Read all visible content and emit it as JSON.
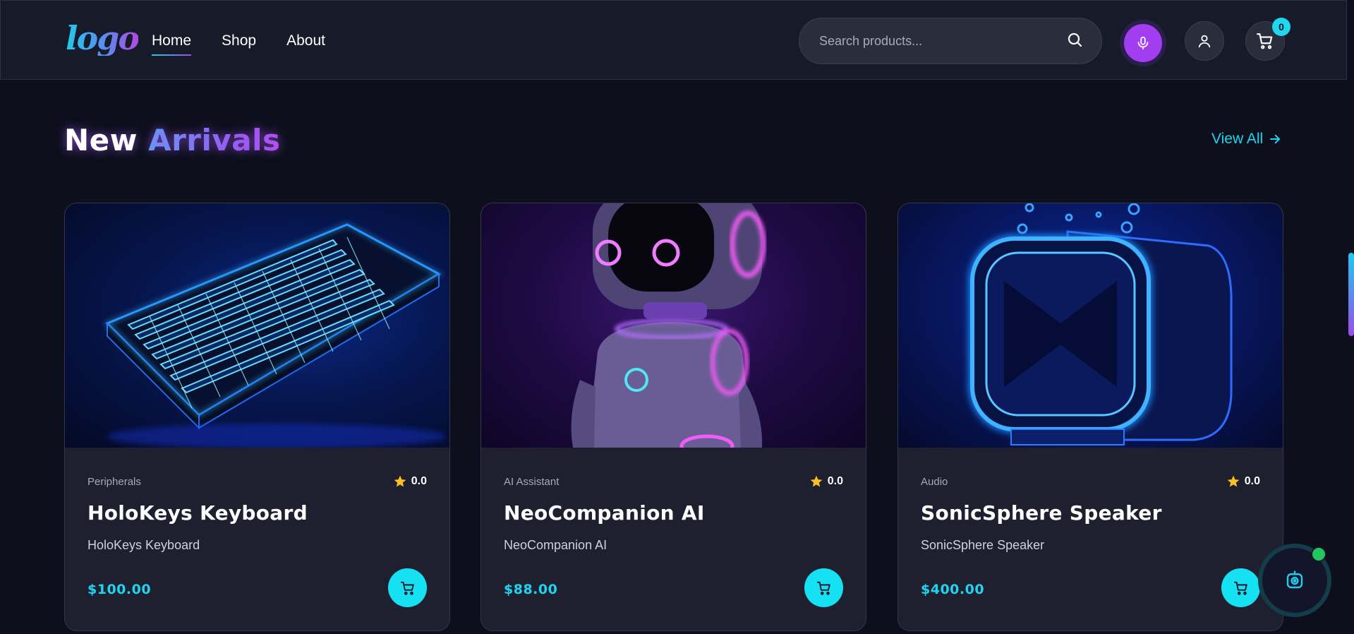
{
  "header": {
    "logo_text": "logo",
    "nav": [
      {
        "label": "Home",
        "active": true
      },
      {
        "label": "Shop",
        "active": false
      },
      {
        "label": "About",
        "active": false
      }
    ],
    "search_placeholder": "Search products...",
    "cart_count": "0"
  },
  "section": {
    "title_main": "New",
    "title_accent": "Arrivals",
    "view_all": "View All"
  },
  "products": [
    {
      "category": "Peripherals",
      "rating": "0.0",
      "name": "HoloKeys Keyboard",
      "description": "HoloKeys Keyboard",
      "price": "$100.00",
      "image": "neon-keyboard"
    },
    {
      "category": "AI Assistant",
      "rating": "0.0",
      "name": "NeoCompanion AI",
      "description": "NeoCompanion AI",
      "price": "$88.00",
      "image": "neon-robot"
    },
    {
      "category": "Audio",
      "rating": "0.0",
      "name": "SonicSphere Speaker",
      "description": "SonicSphere Speaker",
      "price": "$400.00",
      "image": "neon-speaker"
    }
  ],
  "colors": {
    "accent_cyan": "#1fd4ee",
    "accent_purple": "#a23df0",
    "background": "#0d0f1c",
    "card": "#1e2030",
    "online": "#22c55e"
  }
}
